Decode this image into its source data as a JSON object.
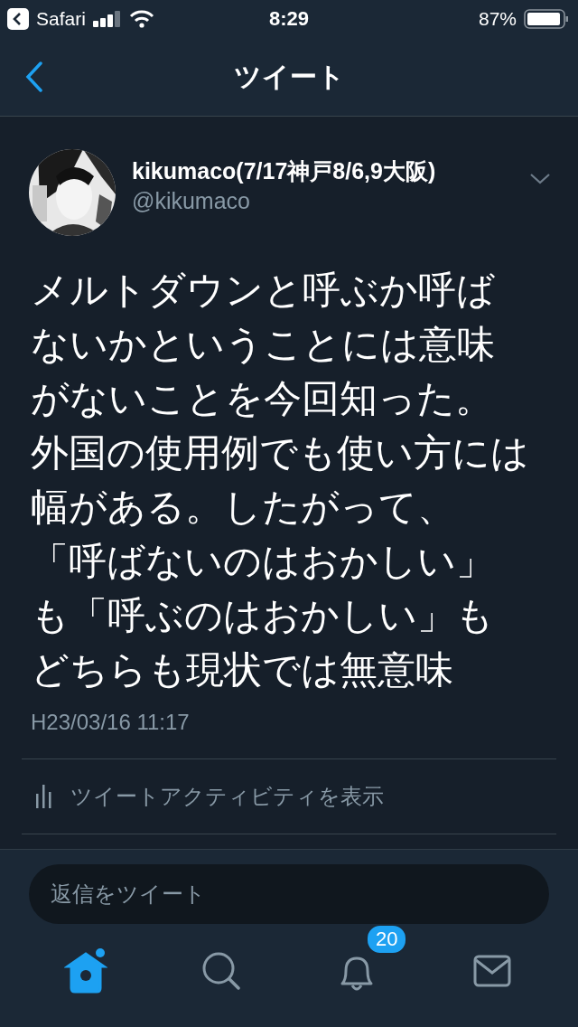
{
  "status_bar": {
    "back_app": "Safari",
    "time": "8:29",
    "battery": "87%"
  },
  "nav": {
    "title": "ツイート"
  },
  "tweet": {
    "display_name": "kikumaco(7/17神戸8/6,9大阪)",
    "handle": "@kikumaco",
    "text": "メルトダウンと呼ぶか呼ばないかということには意味がないことを今回知った。外国の使用例でも使い方には幅がある。したがって、「呼ばないのはおかしい」も「呼ぶのはおかしい」もどちらも現状では無意味",
    "timestamp": "H23/03/16 11:17",
    "activity_link": "ツイートアクティビティを表示"
  },
  "reply": {
    "placeholder": "返信をツイート"
  },
  "tabs": [
    {
      "kind": "home",
      "selected": true,
      "unread": true
    },
    {
      "kind": "search",
      "selected": false
    },
    {
      "kind": "notifications",
      "selected": false,
      "badge": "20"
    },
    {
      "kind": "messages",
      "selected": false
    }
  ]
}
